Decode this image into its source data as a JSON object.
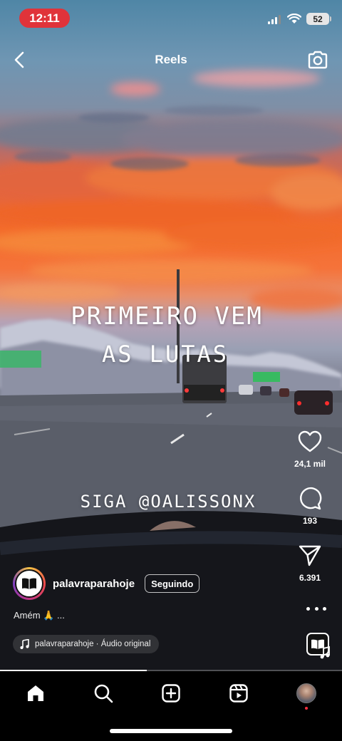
{
  "status_bar": {
    "time": "12:11",
    "battery": "52"
  },
  "header": {
    "title": "Reels"
  },
  "video_overlay": {
    "line1": "PRIMEIRO VEM",
    "line2": "AS LUTAS",
    "line3": "SIGA @OALISSONX"
  },
  "actions": {
    "likes": "24,1 mil",
    "comments": "193",
    "shares": "6.391"
  },
  "author": {
    "username": "palavraparahoje",
    "follow_label": "Seguindo"
  },
  "caption": "Amém 🙏 ...",
  "audio": {
    "label": "palavraparahoje · Áudio original"
  },
  "progress": {
    "fraction": 0.43
  },
  "icons": [
    "back-icon",
    "camera-icon",
    "heart-icon",
    "comment-icon",
    "send-icon",
    "more-icon",
    "music-note-icon",
    "home-icon",
    "search-icon",
    "create-icon",
    "reels-icon",
    "profile-icon"
  ],
  "colors": {
    "time_pill": "#e0333a",
    "notification_dot": "#ff3040"
  }
}
